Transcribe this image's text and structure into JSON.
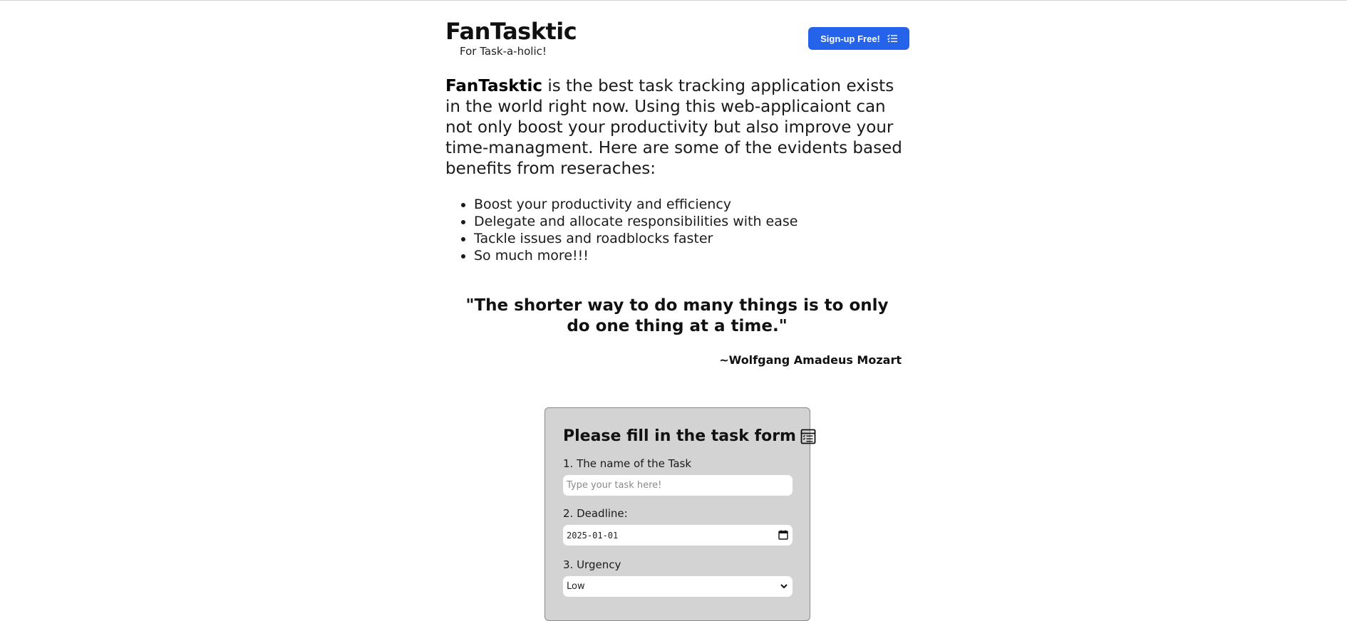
{
  "header": {
    "title": "FanTasktic",
    "tagline": "For Task-a-holic!",
    "signup_label": "Sign-up Free!",
    "signup_icon": "task-list-icon",
    "accent_color": "#2563eb"
  },
  "intro": {
    "brand": "FanTasktic",
    "text": " is the best task tracking application exists in the world right now. Using this web-applicaiont can not only boost your productivity but also improve your time-managment. Here are some of the evidents based benefits from reseraches:"
  },
  "benefits": [
    "Boost your productivity and efficiency",
    "Delegate and allocate responsibilities with ease",
    "Tackle issues and roadblocks faster",
    "So much more!!!"
  ],
  "quote": {
    "text": "\"The shorter way to do many things is to only do one thing at a time.\"",
    "author": "~Wolfgang Amadeus Mozart"
  },
  "form": {
    "title": "Please fill in the task form",
    "title_icon": "clipboard-list-icon",
    "task_name_label": "1. The name of the Task",
    "task_name_placeholder": "Type your task here!",
    "deadline_label": "2. Deadline:",
    "deadline_value": "2025-01-01",
    "deadline_icon": "calendar-icon",
    "urgency_label": "3. Urgency",
    "urgency_value": "Low",
    "urgency_icon": "chevron-down-icon",
    "background_color": "#d3d3d3"
  }
}
